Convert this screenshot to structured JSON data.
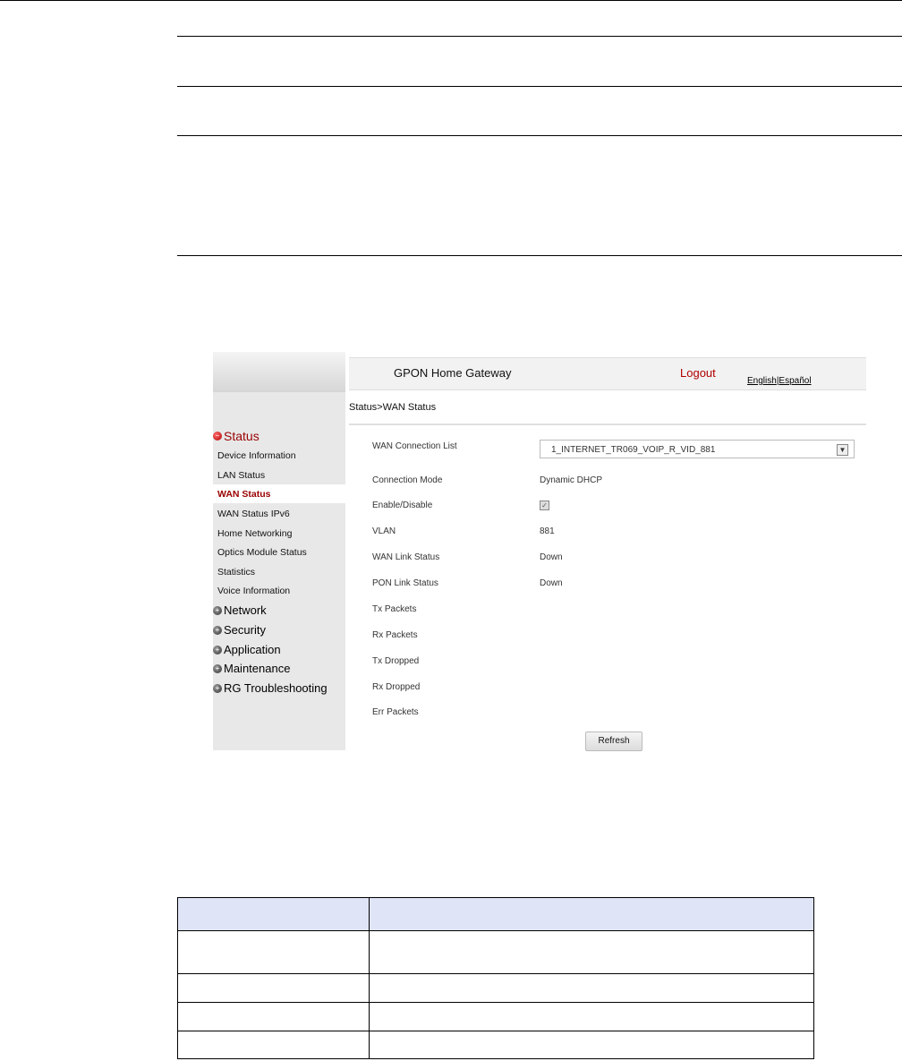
{
  "gateway": {
    "header_title": "GPON Home Gateway",
    "logout_label": "Logout",
    "lang_english": "English",
    "lang_separator": "|",
    "lang_espanol": "Español",
    "breadcrumb": "Status>WAN Status"
  },
  "nav": {
    "status": "Status",
    "status_items": [
      "Device Information",
      "LAN Status",
      "WAN Status",
      "WAN Status IPv6",
      "Home Networking",
      "Optics Module Status",
      "Statistics",
      "Voice Information"
    ],
    "selected_item": "WAN Status",
    "network": "Network",
    "security": "Security",
    "application": "Application",
    "maintenance": "Maintenance",
    "rg": "RG Troubleshooting"
  },
  "wan": {
    "connection_list_label": "WAN Connection List",
    "connection_list_value": "1_INTERNET_TR069_VOIP_R_VID_881",
    "connection_mode_label": "Connection Mode",
    "connection_mode_value": "Dynamic DHCP",
    "enable_label": "Enable/Disable",
    "enable_checked": true,
    "vlan_label": "VLAN",
    "vlan_value": "881",
    "wan_link_label": "WAN Link Status",
    "wan_link_value": "Down",
    "pon_link_label": "PON Link Status",
    "pon_link_value": "Down",
    "tx_packets_label": "Tx Packets",
    "rx_packets_label": "Rx Packets",
    "tx_dropped_label": "Tx Dropped",
    "rx_dropped_label": "Rx Dropped",
    "err_packets_label": "Err Packets",
    "refresh_label": "Refresh"
  },
  "colors": {
    "accent_red": "#990000",
    "table_header": "#dfe5f7"
  }
}
